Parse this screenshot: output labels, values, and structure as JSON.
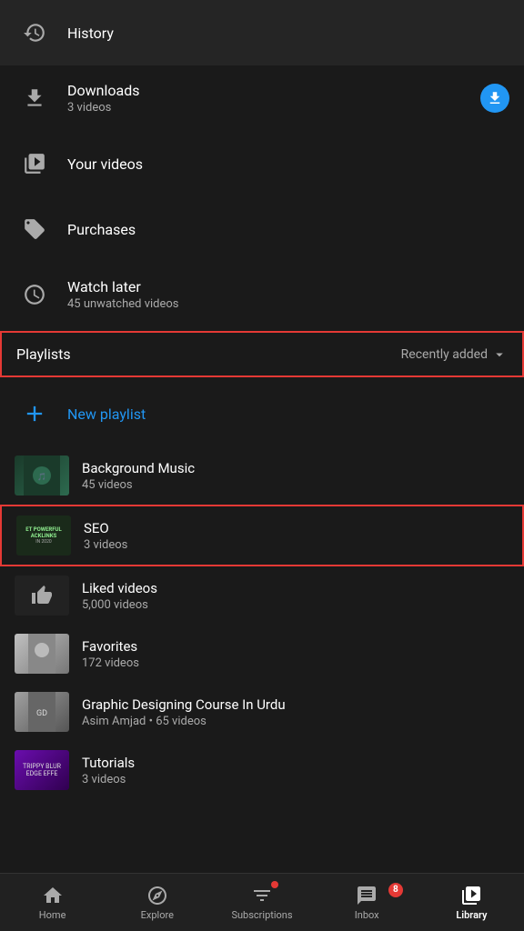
{
  "app": {
    "title": "Library"
  },
  "menu": {
    "history": {
      "label": "History"
    },
    "downloads": {
      "label": "Downloads",
      "sub": "3 videos"
    },
    "your_videos": {
      "label": "Your videos"
    },
    "purchases": {
      "label": "Purchases"
    },
    "watch_later": {
      "label": "Watch later",
      "sub": "45 unwatched videos"
    }
  },
  "playlists_section": {
    "title": "Playlists",
    "sort_label": "Recently added"
  },
  "new_playlist": {
    "label": "New playlist"
  },
  "playlists": [
    {
      "name": "Background Music",
      "meta": "45 videos",
      "thumb_type": "bg1",
      "selected": false
    },
    {
      "name": "SEO",
      "meta": "3 videos",
      "thumb_type": "seo",
      "selected": true
    },
    {
      "name": "Liked videos",
      "meta": "5,000 videos",
      "thumb_type": "liked",
      "selected": false
    },
    {
      "name": "Favorites",
      "meta": "172 videos",
      "thumb_type": "fav",
      "selected": false
    },
    {
      "name": "Graphic Designing Course In Urdu",
      "meta": "Asim Amjad • 65 videos",
      "thumb_type": "gd",
      "selected": false
    },
    {
      "name": "Tutorials",
      "meta": "3 videos",
      "thumb_type": "tut",
      "selected": false
    }
  ],
  "bottom_nav": {
    "items": [
      {
        "id": "home",
        "label": "Home",
        "active": false
      },
      {
        "id": "explore",
        "label": "Explore",
        "active": false
      },
      {
        "id": "subscriptions",
        "label": "Subscriptions",
        "active": false,
        "badge_dot": true
      },
      {
        "id": "inbox",
        "label": "Inbox",
        "active": false,
        "badge": "8"
      },
      {
        "id": "library",
        "label": "Library",
        "active": true
      }
    ]
  }
}
